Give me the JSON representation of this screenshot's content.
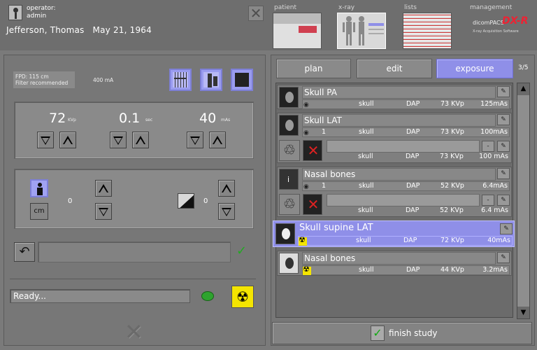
{
  "header": {
    "operator_label": "operator:",
    "operator_name": "admin",
    "patient_name": "Jefferson,  Thomas",
    "patient_dob": "May 21, 1964",
    "nav": [
      {
        "label": "patient"
      },
      {
        "label": "x-ray"
      },
      {
        "label": "lists"
      },
      {
        "label": "management"
      }
    ],
    "logo_text_1": "dicomPACS",
    "logo_text_2": "DX-R",
    "logo_text_3": "X-ray Acquisition Software"
  },
  "left": {
    "fpd_line1": "FPD:      115 cm",
    "fpd_line2": "Filter recommended",
    "mas_top": "400 mA",
    "kv": {
      "value": "72",
      "unit": "KVp"
    },
    "sec": {
      "value": "0.1",
      "unit": "sec"
    },
    "mas": {
      "value": "40",
      "unit": "mAs"
    },
    "cm_label": "cm",
    "pos_value_1": "0",
    "pos_value_2": "0",
    "status_text": "Ready..."
  },
  "right": {
    "tabs": [
      "plan",
      "edit",
      "exposure"
    ],
    "active_tab": "exposure",
    "page_count": "3/5",
    "finish_label": "finish study",
    "exposures": [
      {
        "title": "Skull PA",
        "num": "",
        "region": "skull",
        "dap": "DAP",
        "kvp": "73 KVp",
        "mas": "125mAs",
        "selected": false,
        "sub": null
      },
      {
        "title": "Skull LAT",
        "num": "1",
        "region": "skull",
        "dap": "DAP",
        "kvp": "73 KVp",
        "mas": "100mAs",
        "selected": false,
        "sub": {
          "region": "skull",
          "dap": "DAP",
          "kvp": "73 KVp",
          "mas": "100 mAs",
          "minus": "-"
        }
      },
      {
        "title": "Nasal bones",
        "num": "1",
        "region": "skull",
        "dap": "DAP",
        "kvp": "52 KVp",
        "mas": "6.4mAs",
        "selected": false,
        "sub": {
          "region": "skull",
          "dap": "DAP",
          "kvp": "52 KVp",
          "mas": "6.4 mAs",
          "minus": "-"
        }
      },
      {
        "title": "Skull supine LAT",
        "num": "",
        "region": "skull",
        "dap": "DAP",
        "kvp": "72 KVp",
        "mas": "40mAs",
        "selected": true,
        "sub": null
      },
      {
        "title": "Nasal bones",
        "num": "",
        "region": "skull",
        "dap": "DAP",
        "kvp": "44 KVp",
        "mas": "3.2mAs",
        "selected": false,
        "sub": null
      }
    ]
  },
  "colors": {
    "accent": "#8f8fe8",
    "status_led": "#2ea32e",
    "radiation": "#f4e500"
  },
  "icons": [
    "operator-icon",
    "close-icon",
    "grid-icon",
    "phantom-icon",
    "collimator-icon",
    "person-icon",
    "wedge-icon",
    "undo-icon",
    "signature-check-icon",
    "radiation-icon",
    "edit-icon",
    "eye-icon",
    "recycle-icon",
    "cancel-icon",
    "check-icon"
  ]
}
